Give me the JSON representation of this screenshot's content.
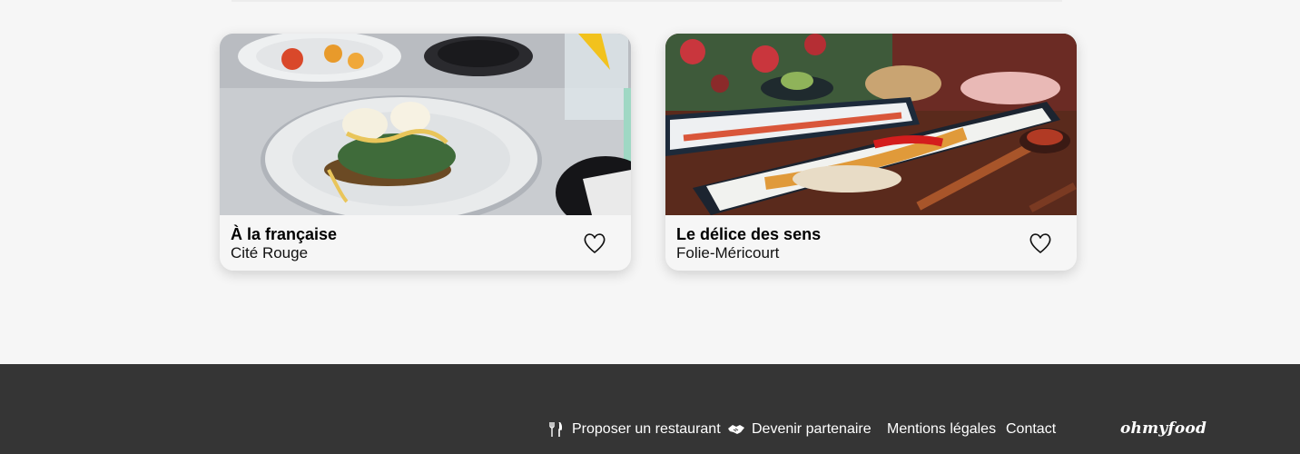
{
  "cards": [
    {
      "title": "À la française",
      "location": "Cité Rouge",
      "favorite_icon": "heart-outline-icon"
    },
    {
      "title": "Le délice des sens",
      "location": "Folie-Méricourt",
      "favorite_icon": "heart-outline-icon"
    }
  ],
  "footer": {
    "links": [
      {
        "label": "Proposer un restaurant",
        "icon": "fork-knife-icon"
      },
      {
        "label": "Devenir partenaire",
        "icon": "handshake-icon"
      },
      {
        "label": "Mentions légales"
      },
      {
        "label": "Contact"
      }
    ],
    "brand": "ohmyfood"
  },
  "colors": {
    "background": "#f6f6f6",
    "footer": "#353535",
    "text": "#000000"
  }
}
